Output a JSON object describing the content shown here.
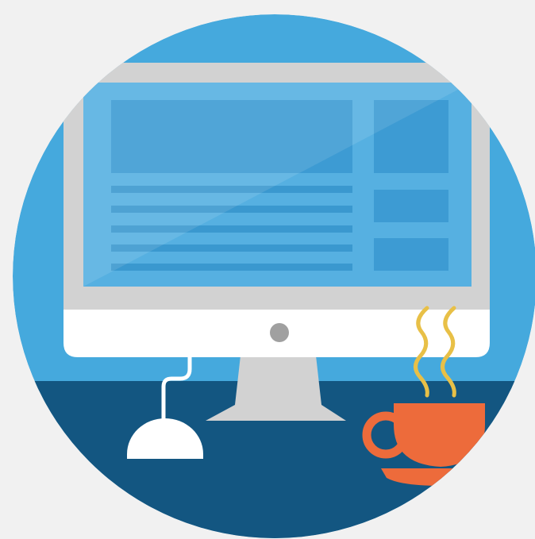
{
  "illustration": {
    "icon_name": "desktop-workspace-icon",
    "colors": {
      "page_background": "#f1f1f1",
      "circle_sky": "#45a9dd",
      "desk": "#135681",
      "monitor_bezel": "#d2d2d2",
      "monitor_chin": "#ffffff",
      "power_button": "#a0a0a0",
      "screen": "#56b0e1",
      "screen_block": "#3d9bd3",
      "screen_line": "#3a98cf",
      "stand": "#d2d2d2",
      "mouse": "#ffffff",
      "mug": "#ed6b3b",
      "steam": "#e8c047"
    },
    "screen_layout": {
      "main_panel": "content-placeholder",
      "text_lines": 5,
      "side_widgets": 3
    },
    "objects": [
      "monitor-icon",
      "mouse-icon",
      "coffee-mug-icon",
      "steam-icon"
    ]
  }
}
